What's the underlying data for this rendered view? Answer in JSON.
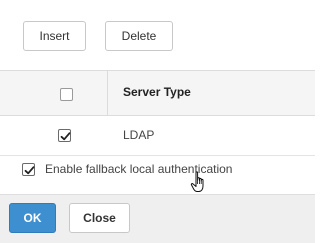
{
  "toolbar": {
    "insert_label": "Insert",
    "delete_label": "Delete"
  },
  "table": {
    "columns": [
      {
        "label": "Server Type"
      }
    ],
    "select_all_checked": false,
    "rows": [
      {
        "server_type": "LDAP",
        "checked": true
      }
    ]
  },
  "fallback": {
    "label": "Enable fallback local authentication",
    "checked": true
  },
  "footer": {
    "ok_label": "OK",
    "close_label": "Close"
  },
  "colors": {
    "primary_button": "#3d8fd0",
    "header_background": "#f5f5f5",
    "footer_background": "#efefef"
  },
  "icons": {
    "cursor": "hand-pointer-icon",
    "check": "checkmark-icon"
  }
}
